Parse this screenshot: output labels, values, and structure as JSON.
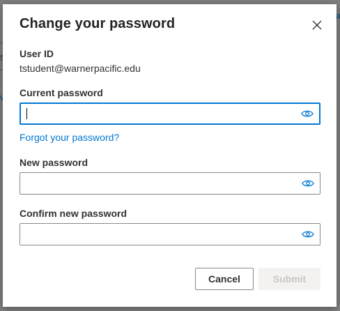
{
  "dialog": {
    "title": "Change your password",
    "user_id_label": "User ID",
    "user_id_value": "tstudent@warnerpacific.edu",
    "current_password_label": "Current password",
    "current_password_value": "",
    "forgot_link": "Forgot your password?",
    "new_password_label": "New password",
    "new_password_value": "",
    "confirm_password_label": "Confirm new password",
    "confirm_password_value": "",
    "cancel_label": "Cancel",
    "submit_label": "Submit",
    "submit_enabled": false,
    "close_icon": "close-icon",
    "reveal_icon": "eye-icon"
  },
  "background": {
    "fragment_left_s": "s",
    "fragment_left_v": "v",
    "fragment_right": "a"
  },
  "colors": {
    "accent": "#0078d4",
    "overlay": "#7f7f7f",
    "disabled_bg": "#f3f2f1",
    "disabled_text": "#c8c6c4"
  }
}
